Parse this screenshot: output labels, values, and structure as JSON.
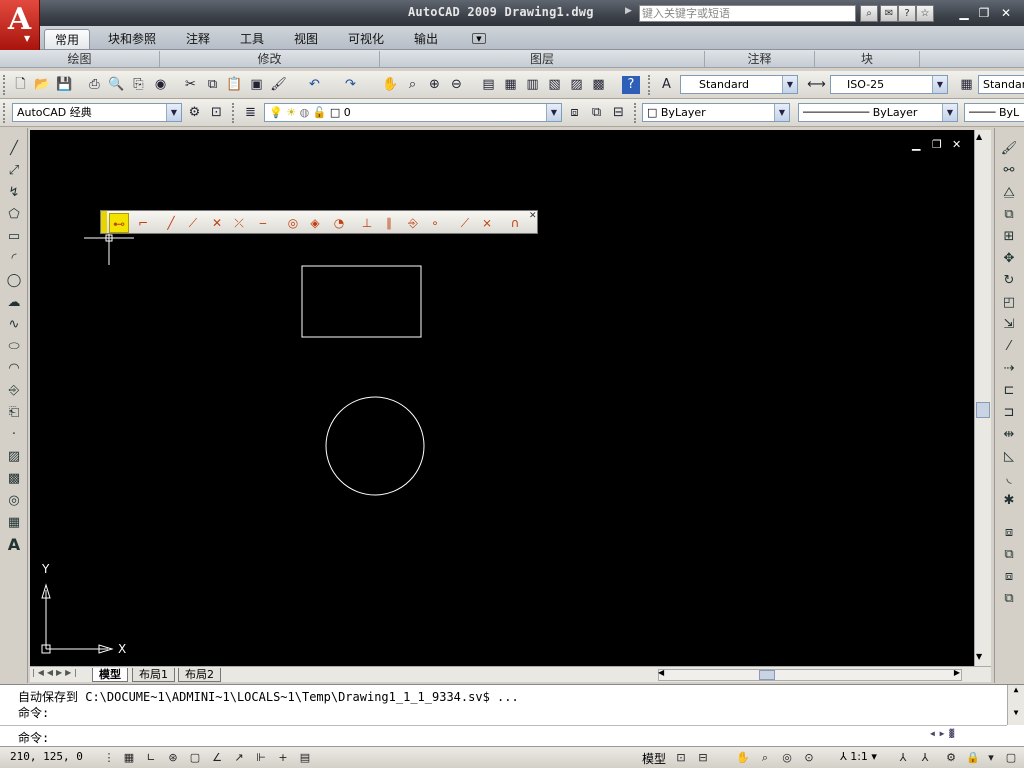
{
  "app": {
    "title": "AutoCAD 2009  Drawing1.dwg",
    "search_placeholder": "键入关键字或短语",
    "logo_letter": "A"
  },
  "ribbon": {
    "tabs": [
      "常用",
      "块和参照",
      "注释",
      "工具",
      "视图",
      "可视化",
      "输出"
    ],
    "active_tab": "常用",
    "panels": [
      "绘图",
      "修改",
      "图层",
      "注释",
      "块"
    ]
  },
  "toolbar": {
    "text_style": "Standard",
    "dim_style": "ISO-25",
    "table_style": "Standar"
  },
  "workspace": {
    "name": "AutoCAD 经典",
    "layer": "0",
    "color": "ByLayer",
    "linetype": "ByLayer",
    "lineweight": "ByL"
  },
  "canvas": {
    "ucs_y": "Y",
    "ucs_x": "X",
    "background": "#000000",
    "shapes": [
      "rectangle",
      "circle"
    ]
  },
  "layout_tabs": [
    "模型",
    "布局1",
    "布局2"
  ],
  "command": {
    "line1": "自动保存到 C:\\DOCUME~1\\ADMINI~1\\LOCALS~1\\Temp\\Drawing1_1_1_9334.sv$ ...",
    "line2": "命令:",
    "prompt": "命令:"
  },
  "status": {
    "coords": "210, 125, 0",
    "model_label": "模型",
    "annotation_scale": "1:1"
  }
}
